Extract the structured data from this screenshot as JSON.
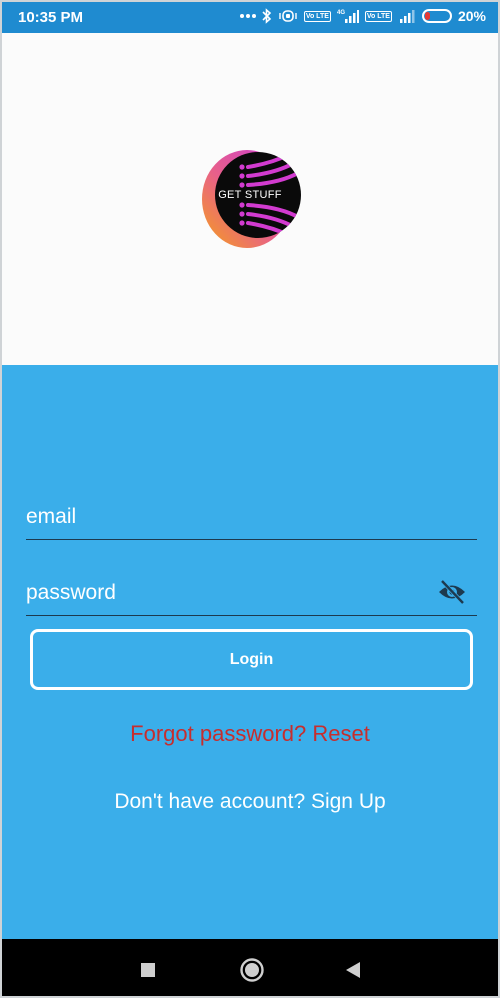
{
  "status_bar": {
    "time": "10:35 PM",
    "battery_percent": "20%",
    "battery_level": 0.2,
    "network_label": "4G",
    "lte_label": "Vo LTE",
    "icons": [
      "more-dots-icon",
      "bluetooth-icon",
      "vibrate-icon",
      "volte-icon",
      "signal-icon",
      "battery-icon"
    ]
  },
  "logo": {
    "text": "GET STUFF",
    "colors": {
      "orange": "#f07a1d",
      "magenta": "#d63ad8",
      "dark": "#0a0a0a"
    }
  },
  "form": {
    "email_placeholder": "email",
    "password_placeholder": "password",
    "login_label": "Login",
    "forgot_text": "Forgot password? Reset",
    "signup_text": "Don't have account? Sign Up"
  },
  "colors": {
    "status_bar": "#1f8bd0",
    "panel": "#3aaeea",
    "forgot": "#c62e2e",
    "underline": "#1d3a4f"
  },
  "nav_bar": {
    "icons": [
      "recents-square-icon",
      "home-circle-icon",
      "back-triangle-icon"
    ]
  }
}
